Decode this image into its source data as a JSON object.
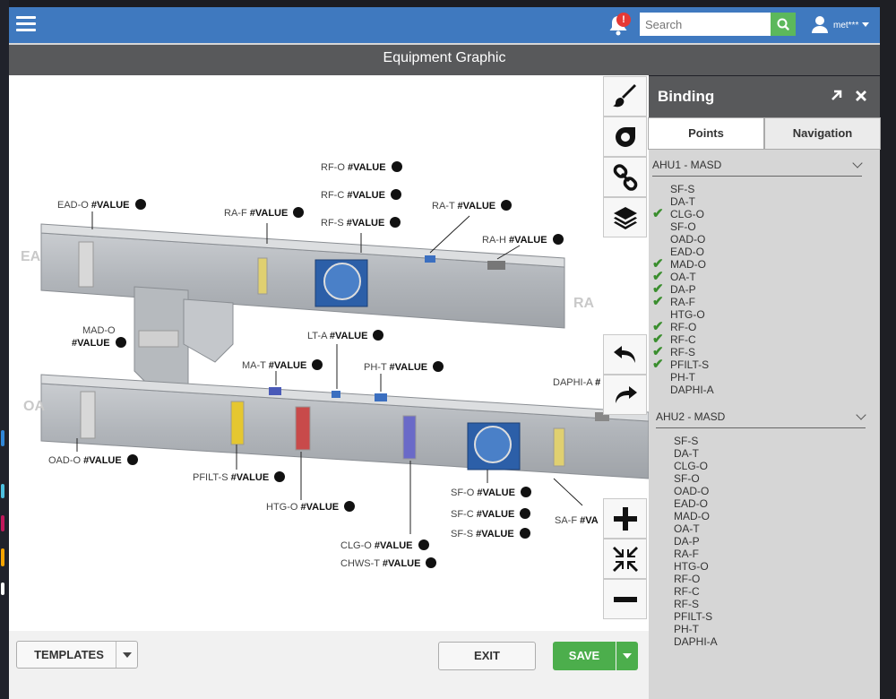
{
  "header": {
    "search_placeholder": "Search",
    "notification_badge": "!",
    "user_name": "met***"
  },
  "page_title": "Equipment Graphic",
  "footer": {
    "templates_label": "TEMPLATES",
    "exit_label": "EXIT",
    "save_label": "SAVE"
  },
  "panel": {
    "title": "Binding",
    "tabs": [
      "Points",
      "Navigation"
    ],
    "groups": [
      {
        "name": "AHU1 - MASD",
        "points": [
          {
            "label": "SF-S",
            "bound": false
          },
          {
            "label": "DA-T",
            "bound": false
          },
          {
            "label": "CLG-O",
            "bound": true
          },
          {
            "label": "SF-O",
            "bound": false
          },
          {
            "label": "OAD-O",
            "bound": false
          },
          {
            "label": "EAD-O",
            "bound": false
          },
          {
            "label": "MAD-O",
            "bound": true
          },
          {
            "label": "OA-T",
            "bound": true
          },
          {
            "label": "DA-P",
            "bound": true
          },
          {
            "label": "RA-F",
            "bound": true
          },
          {
            "label": "HTG-O",
            "bound": false
          },
          {
            "label": "RF-O",
            "bound": true
          },
          {
            "label": "RF-C",
            "bound": true
          },
          {
            "label": "RF-S",
            "bound": true
          },
          {
            "label": "PFILT-S",
            "bound": true
          },
          {
            "label": "PH-T",
            "bound": false
          },
          {
            "label": "DAPHI-A",
            "bound": false
          }
        ]
      },
      {
        "name": "AHU2 - MASD",
        "points": [
          {
            "label": "SF-S",
            "bound": false
          },
          {
            "label": "DA-T",
            "bound": false
          },
          {
            "label": "CLG-O",
            "bound": false
          },
          {
            "label": "SF-O",
            "bound": false
          },
          {
            "label": "OAD-O",
            "bound": false
          },
          {
            "label": "EAD-O",
            "bound": false
          },
          {
            "label": "MAD-O",
            "bound": false
          },
          {
            "label": "OA-T",
            "bound": false
          },
          {
            "label": "DA-P",
            "bound": false
          },
          {
            "label": "RA-F",
            "bound": false
          },
          {
            "label": "HTG-O",
            "bound": false
          },
          {
            "label": "RF-O",
            "bound": false
          },
          {
            "label": "RF-C",
            "bound": false
          },
          {
            "label": "RF-S",
            "bound": false
          },
          {
            "label": "PFILT-S",
            "bound": false
          },
          {
            "label": "PH-T",
            "bound": false
          },
          {
            "label": "DAPHI-A",
            "bound": false
          }
        ]
      }
    ]
  },
  "diagram": {
    "zones": {
      "ea": "EA",
      "oa": "OA",
      "ra": "RA"
    },
    "value_text": "#VALUE",
    "labels": {
      "rf_o": "RF-O",
      "rf_c": "RF-C",
      "rf_s": "RF-S",
      "ead_o": "EAD-O",
      "ra_f": "RA-F",
      "ra_t": "RA-T",
      "ra_h": "RA-H",
      "mad_o": "MAD-O",
      "lt_a": "LT-A",
      "ma_t": "MA-T",
      "ph_t": "PH-T",
      "daphi_a": "DAPHI-A",
      "oad_o": "OAD-O",
      "pfilt_s": "PFILT-S",
      "htg_o": "HTG-O",
      "sf_o": "SF-O",
      "sf_c": "SF-C",
      "sf_s": "SF-S",
      "sa_f": "SA-F",
      "clg_o": "CLG-O",
      "chws_t": "CHWS-T"
    }
  },
  "colors": {
    "navbar": "#3f79bf",
    "titlebar": "#58595b",
    "save": "#4cae4c",
    "search_button": "#5cb85c",
    "check": "#3a8e2e",
    "badge": "#e53935"
  }
}
